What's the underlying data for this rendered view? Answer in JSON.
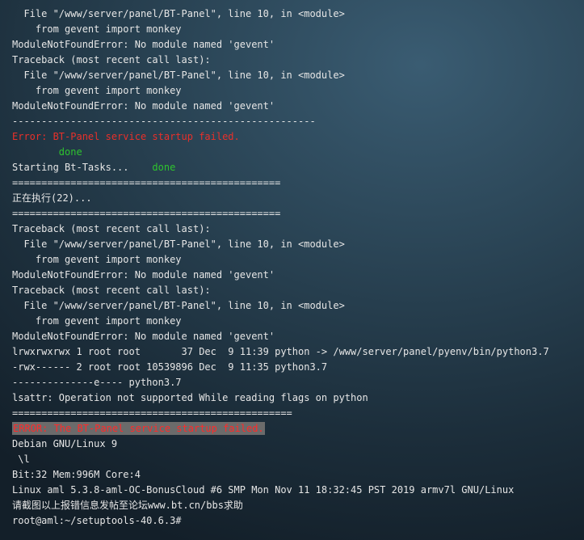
{
  "terminal": {
    "lines": [
      "  File \"/www/server/panel/BT-Panel\", line 10, in <module>",
      "    from gevent import monkey",
      "ModuleNotFoundError: No module named 'gevent'",
      "Traceback (most recent call last):",
      "  File \"/www/server/panel/BT-Panel\", line 10, in <module>",
      "    from gevent import monkey",
      "ModuleNotFoundError: No module named 'gevent'",
      "----------------------------------------------------",
      "Error: BT-Panel service startup failed.",
      "        done",
      "Starting Bt-Tasks...    done",
      "==============================================",
      "正在执行(22)...",
      "==============================================",
      "Traceback (most recent call last):",
      "  File \"/www/server/panel/BT-Panel\", line 10, in <module>",
      "    from gevent import monkey",
      "ModuleNotFoundError: No module named 'gevent'",
      "Traceback (most recent call last):",
      "  File \"/www/server/panel/BT-Panel\", line 10, in <module>",
      "    from gevent import monkey",
      "ModuleNotFoundError: No module named 'gevent'",
      "lrwxrwxrwx 1 root root       37 Dec  9 11:39 python -> /www/server/panel/pyenv/bin/python3.7",
      "-rwx------ 2 root root 10539896 Dec  9 11:35 python3.7",
      "--------------e---- python3.7",
      "lsattr: Operation not supported While reading flags on python",
      "================================================",
      "ERROR: The BT-Panel service startup failed.",
      "Debian GNU/Linux 9",
      " \\l",
      "Bit:32 Mem:996M Core:4",
      "Linux aml 5.3.8-aml-OC-BonusCloud #6 SMP Mon Nov 11 18:32:45 PST 2019 armv7l GNU/Linux",
      "请截图以上报错信息发帖至论坛www.bt.cn/bbs求助",
      "root@aml:~/setuptools-40.6.3#"
    ],
    "line_styles": {
      "8": "err",
      "9": "ok",
      "27": "err-hl"
    },
    "inline_ok": {
      "10": {
        "prefix": "Starting Bt-Tasks...    ",
        "suffix": "done"
      }
    },
    "colors": {
      "error": "#e8302a",
      "success": "#2ec42e",
      "highlight_bg": "#6b6b6b",
      "text": "#e6e6e6"
    }
  }
}
